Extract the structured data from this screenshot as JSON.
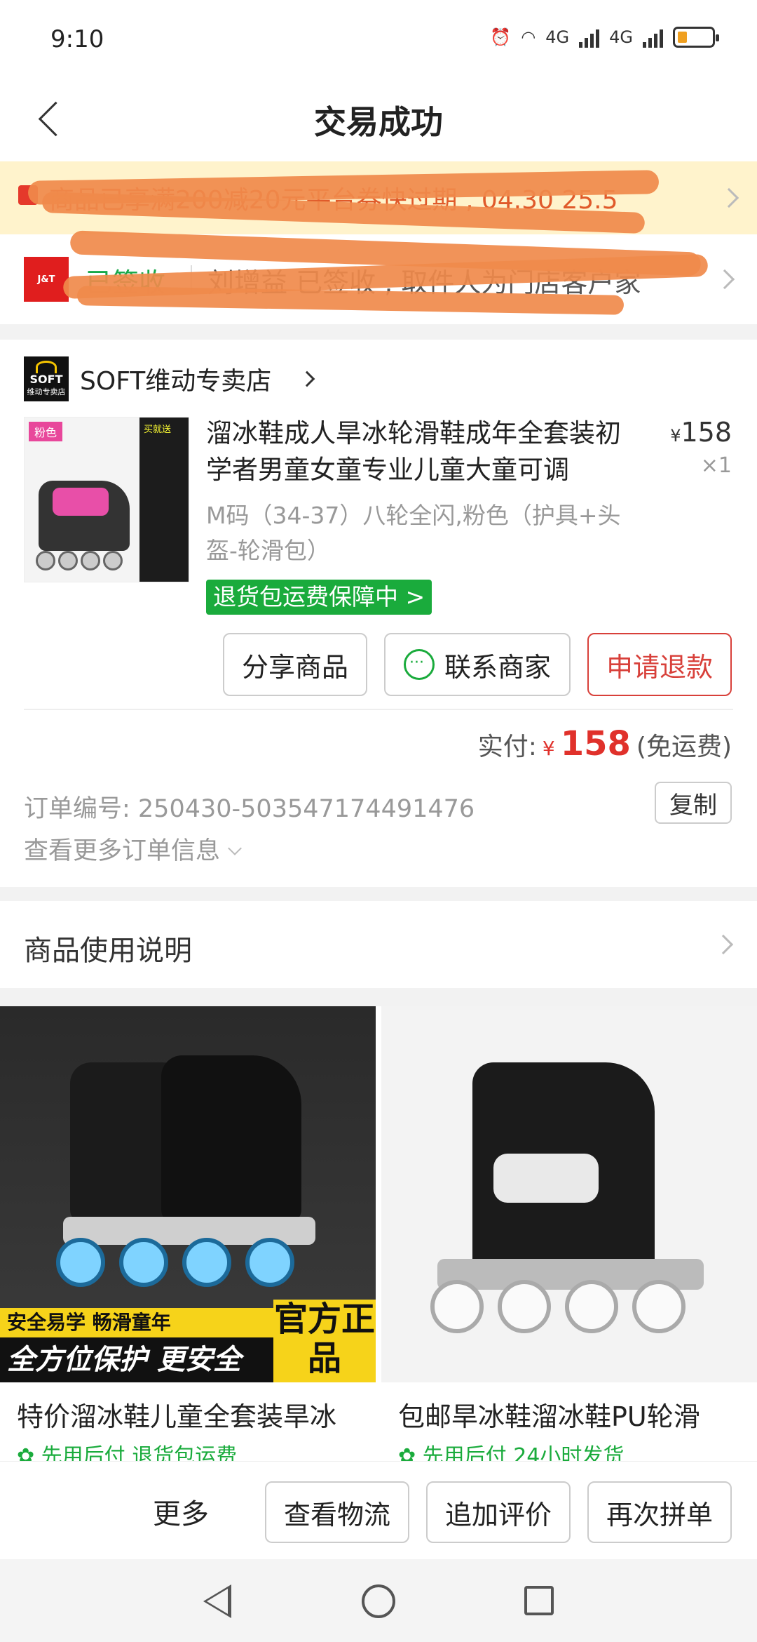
{
  "status_bar": {
    "time": "9:10",
    "network1": "4G",
    "network2": "4G"
  },
  "header": {
    "title": "交易成功"
  },
  "notice": {
    "text": "商品已享满200减20元平台券快过期 , 04.30 25.5"
  },
  "logistics": {
    "status": "已签收",
    "info": "刘增益 已签收 , 取件人为门店客户家"
  },
  "store": {
    "logo_text": "SOFT",
    "logo_sub": "维动专卖店",
    "name": "SOFT维动专卖店",
    "product": {
      "image_tag": "粉色",
      "image_tag2": "买就送",
      "title": "溜冰鞋成人旱冰轮滑鞋成年全套装初学者男童女童专业儿童大童可调",
      "currency": "¥",
      "price": "158",
      "qty": "×1",
      "spec": "M码（34-37）八轮全闪,粉色（护具+头盔-轮滑包）",
      "badge": "退货包运费保障中 >"
    },
    "actions": {
      "share": "分享商品",
      "contact": "联系商家",
      "refund": "申请退款"
    },
    "payment": {
      "label": "实付:",
      "currency": "¥",
      "amount": "158",
      "shipping": "(免运费)"
    },
    "order": {
      "number_label": "订单编号: 250430-503547174491476",
      "copy": "复制",
      "more": "查看更多订单信息"
    }
  },
  "usage": {
    "title": "商品使用说明"
  },
  "recommendations": [
    {
      "title": "特价溜冰鞋儿童全套装旱冰",
      "sub": "先用后付 退货包运费",
      "promo_line1": "安全易学 畅滑童年",
      "promo_line2": "全方位保护 更安全",
      "promo_badge": "官方正品"
    },
    {
      "title": "包邮旱冰鞋溜冰鞋PU轮滑",
      "sub": "先用后付 24小时发货"
    }
  ],
  "bottom_bar": {
    "more": "更多",
    "logistics": "查看物流",
    "review": "追加评价",
    "reorder": "再次拼单"
  },
  "colors": {
    "accent_red": "#e0312b",
    "green": "#1aab3c",
    "notice_bg": "#fff3cc",
    "scribble": "#f08a4b"
  }
}
